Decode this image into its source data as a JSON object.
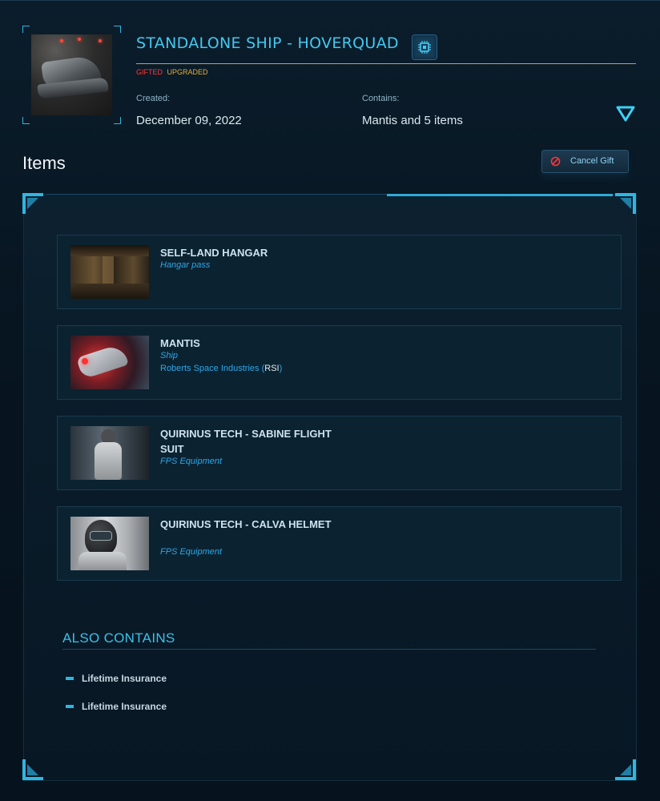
{
  "header": {
    "title": "STANDALONE SHIP - HOVERQUAD",
    "tag_gifted": "GIFTED",
    "tag_upgraded": "UPGRADED",
    "created_label": "Created:",
    "created_value": "December 09, 2022",
    "contains_label": "Contains:",
    "contains_value": "Mantis and 5 items",
    "chip_icon": "chip-icon",
    "expand_icon": "triangle-down-icon"
  },
  "items_section": {
    "heading": "Items",
    "cancel_gift_label": "Cancel Gift",
    "cancel_icon": "prohibited-icon"
  },
  "items": [
    {
      "name": "SELF-LAND HANGAR",
      "type": "Hangar pass",
      "manufacturer": "",
      "manufacturer_code": ""
    },
    {
      "name": "MANTIS",
      "type": "Ship",
      "manufacturer": "Roberts Space Industries",
      "manufacturer_code": "RSI"
    },
    {
      "name": "QUIRINUS TECH - SABINE FLIGHT SUIT",
      "type": "FPS Equipment",
      "manufacturer": "",
      "manufacturer_code": ""
    },
    {
      "name": "QUIRINUS TECH - CALVA HELMET",
      "type": "FPS Equipment",
      "manufacturer": "",
      "manufacturer_code": ""
    }
  ],
  "also_contains": {
    "title": "ALSO CONTAINS",
    "entries": [
      "Lifetime Insurance",
      "Lifetime Insurance"
    ]
  },
  "colors": {
    "accent": "#44c8f0",
    "gifted": "#ff3b3b",
    "upgraded": "#e3b038",
    "link": "#2ea7e6"
  }
}
